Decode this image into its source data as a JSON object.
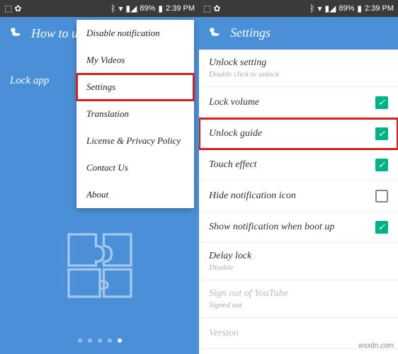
{
  "status": {
    "battery": "89%",
    "time": "2:39 PM"
  },
  "left": {
    "header_title": "How to use",
    "lock_app": "Lock app",
    "menu": [
      "Disable notification",
      "My Videos",
      "Settings",
      "Translation",
      "License & Privacy Policy",
      "Contact Us",
      "About"
    ],
    "menu_highlight_index": 2,
    "dots_count": 5,
    "dots_active_index": 4
  },
  "right": {
    "header_title": "Settings",
    "rows": [
      {
        "label": "Unlock setting",
        "sub": "Double click to unlock",
        "checkbox": null
      },
      {
        "label": "Lock volume",
        "checkbox": true
      },
      {
        "label": "Unlock guide",
        "checkbox": true,
        "highlighted": true
      },
      {
        "label": "Touch effect",
        "checkbox": true
      },
      {
        "label": "Hide notification icon",
        "checkbox": false
      },
      {
        "label": "Show notification when boot up",
        "checkbox": true
      },
      {
        "label": "Delay lock",
        "sub": "Disable",
        "checkbox": null
      },
      {
        "label": "Sign out of YouTube",
        "sub": "Signed out",
        "checkbox": null,
        "disabled": true
      },
      {
        "label": "Version",
        "checkbox": null,
        "disabled": true
      }
    ]
  },
  "watermark": "wsxdn.com"
}
